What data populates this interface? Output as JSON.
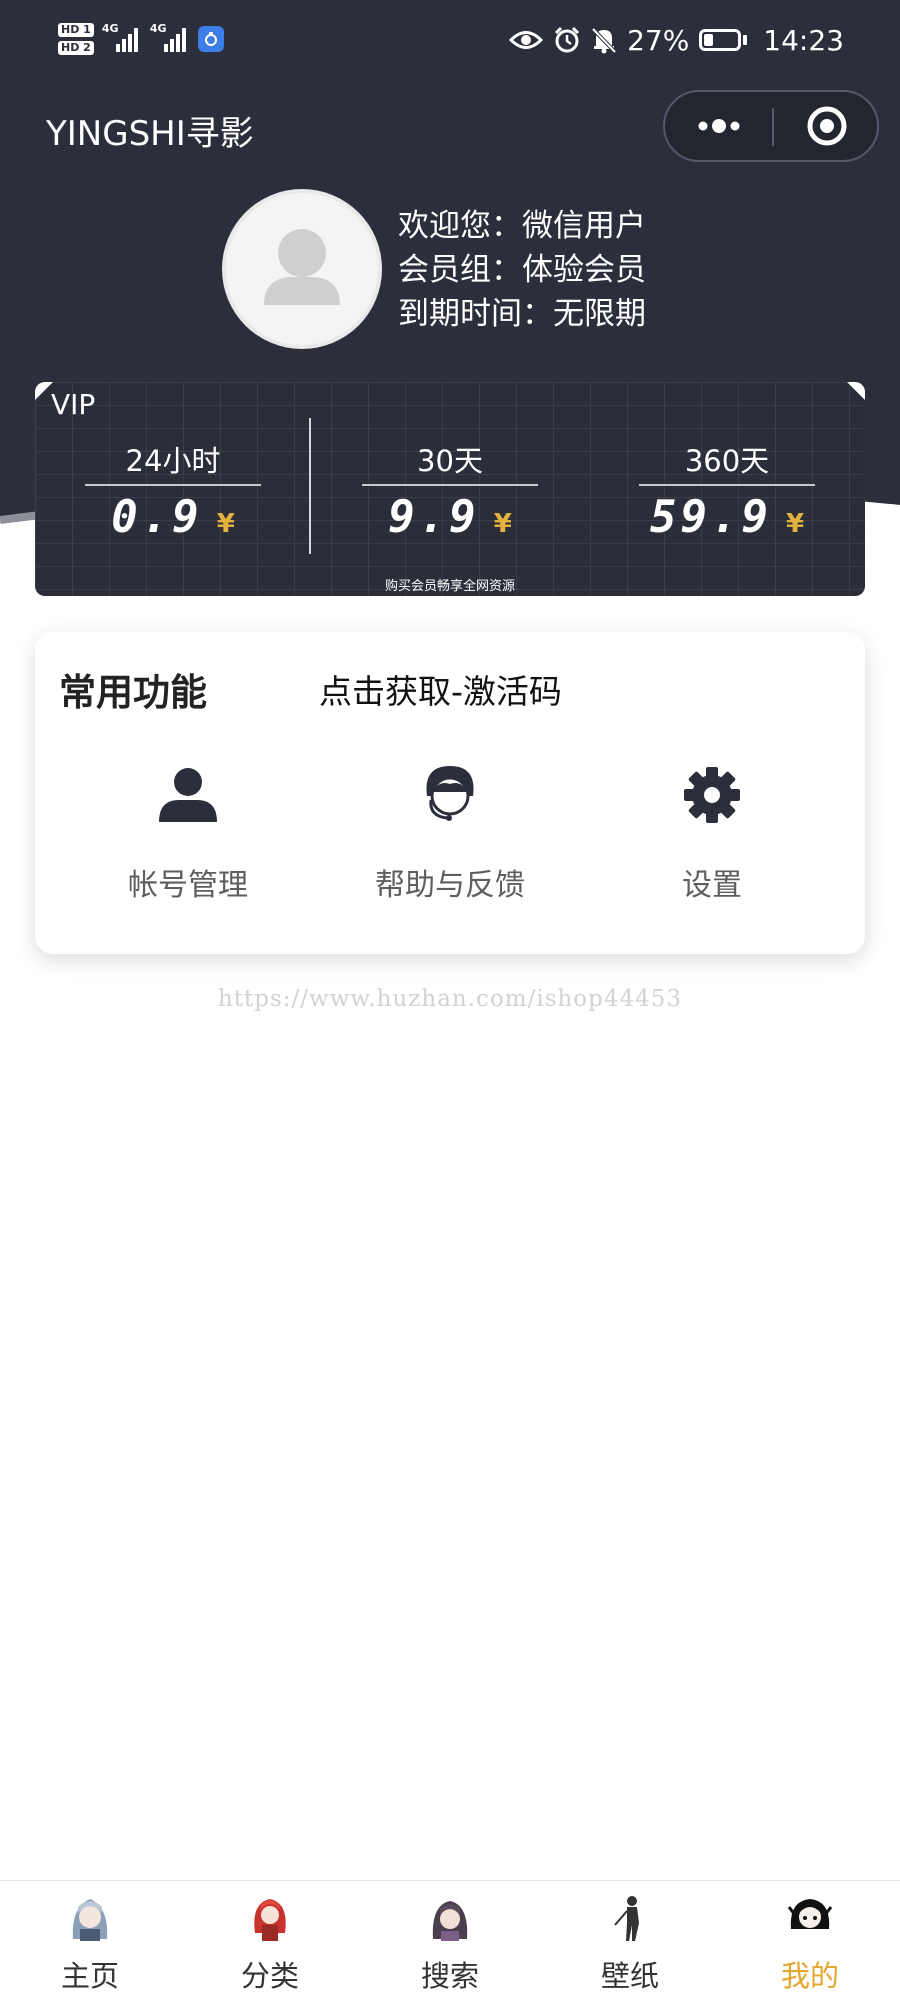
{
  "status_bar": {
    "sim1": "HD 1",
    "sim2": "HD 2",
    "network1": "4G",
    "network2": "4G",
    "battery": "27%",
    "battery_level": 0.27,
    "time": "14:23",
    "icons": [
      "eye-icon",
      "alarm-icon",
      "bell-off-icon",
      "battery-icon"
    ]
  },
  "header": {
    "title": "YINGSHI寻影",
    "more_icon": "more-dots-icon",
    "close_icon": "target-close-icon"
  },
  "profile": {
    "welcome": "欢迎您：微信用户",
    "group": "会员组：体验会员",
    "expire": "到期时间：无限期"
  },
  "vip": {
    "label": "VIP",
    "plans": [
      {
        "name": "24小时",
        "price": "0.9",
        "currency": "¥"
      },
      {
        "name": "30天",
        "price": "9.9",
        "currency": "¥"
      },
      {
        "name": "360天",
        "price": "59.9",
        "currency": "¥"
      }
    ],
    "note": "购买会员畅享全网资源"
  },
  "functions": {
    "title": "常用功能",
    "link": "点击获取-激活码",
    "items": [
      {
        "label": "帐号管理",
        "icon": "user-icon"
      },
      {
        "label": "帮助与反馈",
        "icon": "customer-service-icon"
      },
      {
        "label": "设置",
        "icon": "gear-icon"
      }
    ]
  },
  "watermark": "https://www.huzhan.com/ishop44453",
  "tabs": [
    {
      "label": "主页",
      "icon": "anime-girl-home-icon",
      "active": false
    },
    {
      "label": "分类",
      "icon": "anime-girl-category-icon",
      "active": false
    },
    {
      "label": "搜索",
      "icon": "anime-girl-search-icon",
      "active": false
    },
    {
      "label": "壁纸",
      "icon": "silhouette-wallpaper-icon",
      "active": false
    },
    {
      "label": "我的",
      "icon": "anime-girl-mine-icon",
      "active": true
    }
  ],
  "colors": {
    "header_bg": "#2c2e3b",
    "accent": "#e3a72f",
    "price_currency": "#e3b23c"
  }
}
